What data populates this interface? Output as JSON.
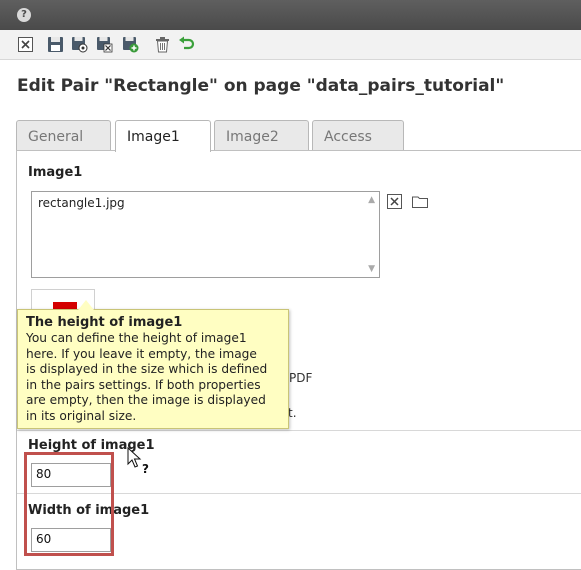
{
  "toolbar": {
    "icons": [
      "close-icon",
      "save-icon",
      "save-view-icon",
      "save-close-icon",
      "save-new-icon",
      "delete-icon",
      "undo-icon"
    ]
  },
  "page_title": "Edit Pair \"Rectangle\" on page \"data_pairs_tutorial\"",
  "tabs": [
    {
      "label": "General",
      "active": false
    },
    {
      "label": "Image1",
      "active": true
    },
    {
      "label": "Image2",
      "active": false
    },
    {
      "label": "Access",
      "active": false
    }
  ],
  "image_section": {
    "label": "Image1",
    "file_value": "rectangle1.jpg"
  },
  "hidden_fragments": [
    "PDF",
    "t."
  ],
  "height_field": {
    "label": "Height of image1",
    "value": "80"
  },
  "width_field": {
    "label": "Width of image1",
    "value": "60"
  },
  "tooltip": {
    "title": "The height of image1",
    "lines": [
      "You can define the height of image1",
      "here. If you leave it empty, the image",
      "is displayed in the size which is defined",
      "in the pairs settings. If both properties",
      "are empty, then the image is displayed",
      "in its original size."
    ]
  },
  "colors": {
    "topbar": "#4f4f4f",
    "tooltip_bg": "#fffec2",
    "highlight_border": "#c0504d",
    "thumb_rect": "#d40000"
  }
}
